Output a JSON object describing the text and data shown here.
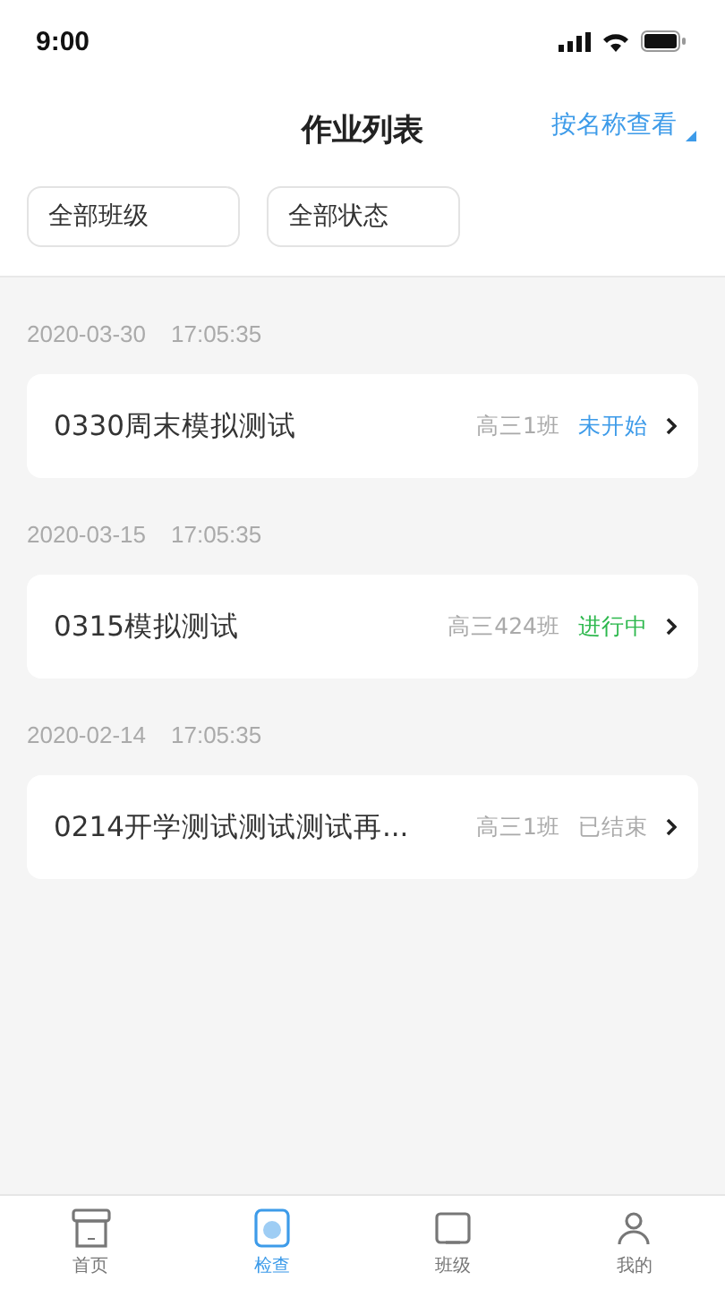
{
  "status_bar": {
    "time": "9:00"
  },
  "header": {
    "title": "作业列表",
    "view_toggle": "按名称查看"
  },
  "filters": [
    {
      "label": "全部班级"
    },
    {
      "label": "全部状态"
    }
  ],
  "groups": [
    {
      "datetime": [
        "2020-03-30",
        "17:05:35"
      ],
      "item": {
        "title": "0330周末模拟测试",
        "class": "高三1班",
        "status": "未开始",
        "color": "#3d9be9"
      }
    },
    {
      "datetime": [
        "2020-03-15",
        "17:05:35"
      ],
      "item": {
        "title": "0315模拟测试",
        "class": "高三424班",
        "status": "进行中",
        "color": "#2db84d"
      }
    },
    {
      "datetime": [
        "2020-02-14",
        "17:05:35"
      ],
      "item": {
        "title": "0214开学测试测试测试再...",
        "class": "高三1班",
        "status": "已结束",
        "color": "#aaaaaa"
      }
    }
  ],
  "tab_bar": [
    {
      "label": "首页",
      "kind": "home",
      "selected": false
    },
    {
      "label": "检查",
      "kind": "check",
      "selected": true
    },
    {
      "label": "班级",
      "kind": "class",
      "selected": false
    },
    {
      "label": "我的",
      "kind": "me",
      "selected": false
    }
  ]
}
